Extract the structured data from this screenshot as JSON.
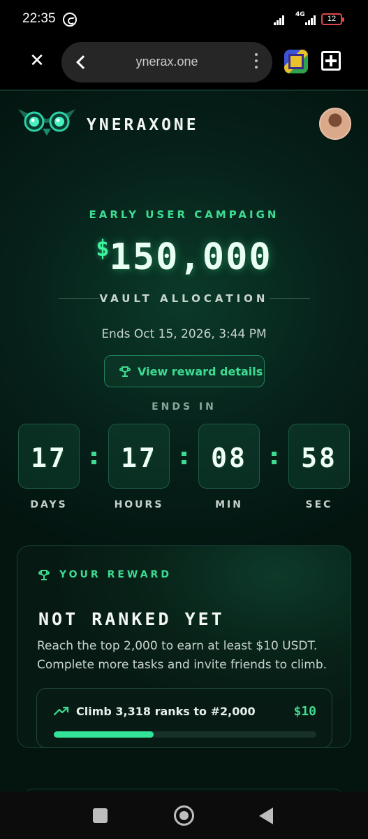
{
  "status_bar": {
    "time": "22:35",
    "network": "4G",
    "battery": "12"
  },
  "browser": {
    "url": "ynerax.one",
    "icons": [
      "close-icon",
      "back-icon",
      "more-vert-icon",
      "extension-icon",
      "new-tab-icon"
    ]
  },
  "header": {
    "brand": "YNERAXONE",
    "logo_icon": "owl-logo-icon",
    "avatar_icon": "user-avatar"
  },
  "hero": {
    "campaign_label": "EARLY USER CAMPAIGN",
    "currency_symbol": "$",
    "amount": "150,000",
    "subtitle": "VAULT ALLOCATION",
    "ends_date": "Ends Oct 15, 2026, 3:44 PM",
    "reward_button_label": "View reward details",
    "ends_in_label": "ENDS IN"
  },
  "countdown": [
    {
      "value": "17",
      "label": "DAYS"
    },
    {
      "value": "17",
      "label": "HOURS"
    },
    {
      "value": "08",
      "label": "MIN"
    },
    {
      "value": "58",
      "label": "SEC"
    }
  ],
  "reward_card": {
    "heading": "YOUR REWARD",
    "status": "NOT RANKED YET",
    "description": "Reach the top 2,000 to earn at least $10 USDT. Complete more tasks and invite friends to climb.",
    "progress": {
      "text": "Climb 3,318 ranks to #2,000",
      "prize": "$10",
      "fraction": 0.38
    }
  },
  "colors": {
    "accent": "#3ddc92",
    "background": "#06211a",
    "text": "#e8f2ec"
  }
}
